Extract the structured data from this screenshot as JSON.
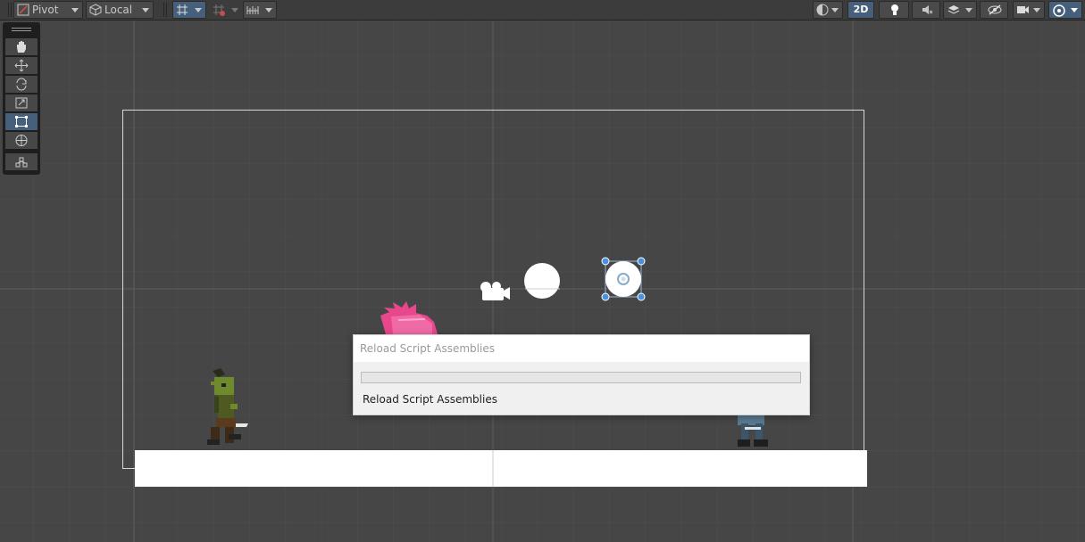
{
  "toolbar": {
    "pivot_label": "Pivot",
    "local_label": "Local",
    "twod_label": "2D"
  },
  "dialog": {
    "title": "Reload Script Assemblies",
    "message": "Reload Script Assemblies",
    "progress": 0
  },
  "colors": {
    "scene_bg": "#464646",
    "toolbar_bg": "#3c3c3c",
    "active_blue": "#46607c",
    "handle_blue": "#4a90e2"
  }
}
